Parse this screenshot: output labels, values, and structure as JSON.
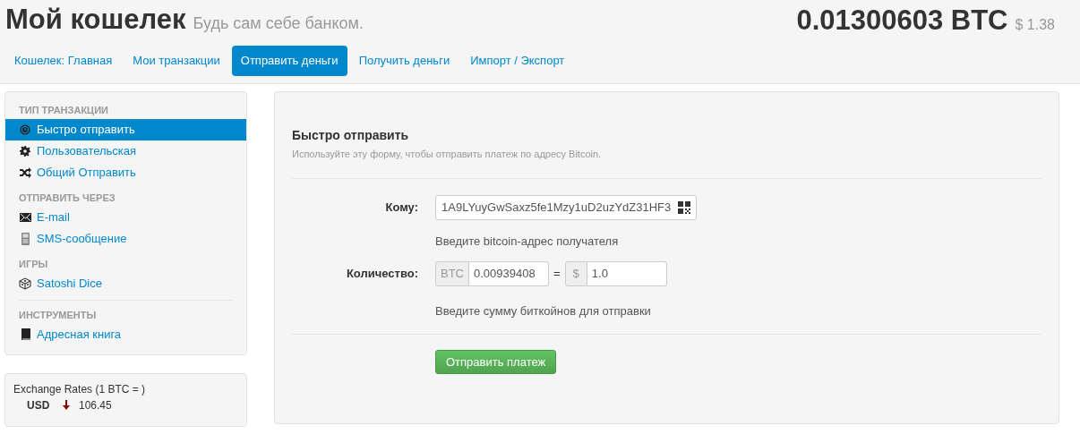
{
  "header": {
    "title": "Мой кошелек",
    "subtitle": "Будь сам себе банком.",
    "balance": "0.01300603 BTC",
    "balance_usd": "$ 1.38"
  },
  "tabs": [
    {
      "label": "Кошелек: Главная",
      "selected": false
    },
    {
      "label": "Мои транзакции",
      "selected": false
    },
    {
      "label": "Отправить деньги",
      "selected": true
    },
    {
      "label": "Получить деньги",
      "selected": false
    },
    {
      "label": "Импорт / Экспорт",
      "selected": false
    }
  ],
  "sidebar": {
    "sections": [
      {
        "heading": "ТИП ТРАНЗАКЦИИ",
        "items": [
          {
            "label": "Быстро отправить",
            "selected": true
          },
          {
            "label": "Пользовательская",
            "selected": false
          },
          {
            "label": "Общий Отправить",
            "selected": false
          }
        ]
      },
      {
        "heading": "ОТПРАВИТЬ ЧЕРЕЗ",
        "items": [
          {
            "label": "E-mail",
            "selected": false
          },
          {
            "label": "SMS-сообщение",
            "selected": false
          }
        ]
      },
      {
        "heading": "ИГРЫ",
        "items": [
          {
            "label": "Satoshi Dice",
            "selected": false
          }
        ]
      },
      {
        "heading": "ИНСТРУМЕНТЫ",
        "items": [
          {
            "label": "Адресная книга",
            "selected": false
          }
        ]
      }
    ]
  },
  "exchange": {
    "title": "Exchange Rates (1 BTC = )",
    "rates": [
      {
        "currency": "USD",
        "value": "106.45"
      }
    ]
  },
  "form": {
    "title": "Быстро отправить",
    "description": "Используйте эту форму, чтобы отправить платеж по адресу Bitcoin.",
    "to_label": "Кому:",
    "to_value": "1A9LYuyGwSaxz5fe1Mzy1uD2uzYdZ31HF3",
    "to_help": "Введите bitcoin-адрес получателя",
    "amount_label": "Количество:",
    "btc_prefix": "BTC",
    "btc_value": "0.00939408",
    "equals": "=",
    "usd_prefix": "$",
    "usd_value": "1.0",
    "amount_help": "Введите сумму биткойнов для отправки",
    "submit": "Отправить платеж"
  }
}
